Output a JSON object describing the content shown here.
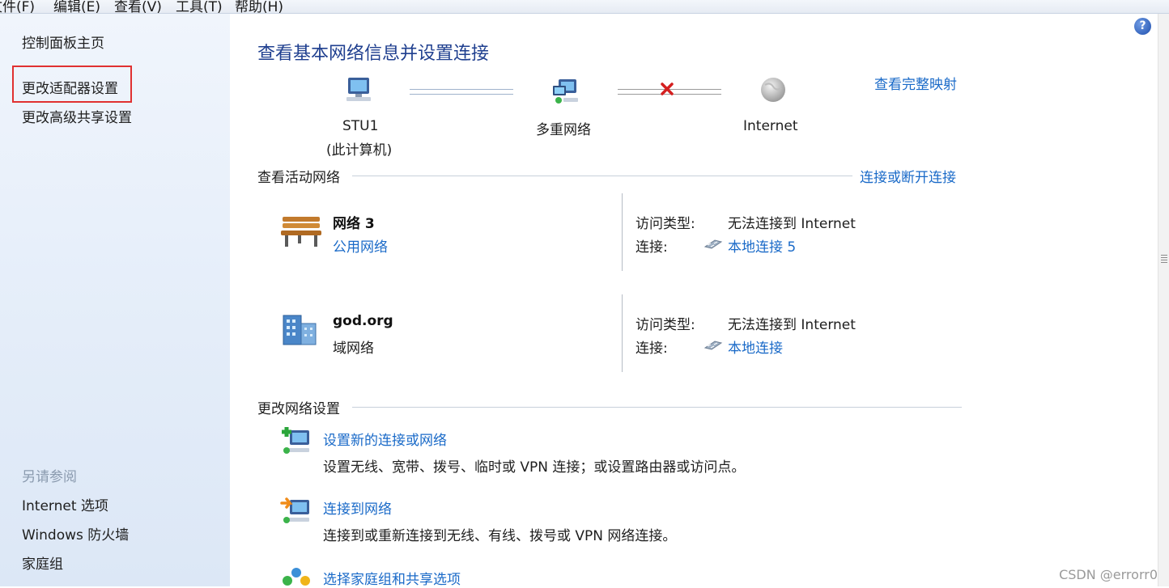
{
  "menu": [
    "文件(F)",
    "编辑(E)",
    "查看(V)",
    "工具(T)",
    "帮助(H)"
  ],
  "sidebar": {
    "home": "控制面板主页",
    "links": [
      "更改适配器设置",
      "更改高级共享设置"
    ],
    "see_also_label": "另请参阅",
    "see_also": [
      "Internet 选项",
      "Windows 防火墙",
      "家庭组"
    ]
  },
  "main": {
    "title": "查看基本网络信息并设置连接",
    "map_link": "查看完整映射",
    "map": {
      "computer_name": "STU1",
      "computer_sub": "(此计算机)",
      "network": "多重网络",
      "internet": "Internet"
    },
    "active_section": "查看活动网络",
    "connect_link": "连接或断开连接",
    "networks": [
      {
        "name": "网络  3",
        "type": "公用网络",
        "access_label": "访问类型:",
        "access_value": "无法连接到 Internet",
        "conn_label": "连接:",
        "conn_value": "本地连接 5",
        "icon": "park-bench-icon"
      },
      {
        "name": "god.org",
        "type": "域网络",
        "access_label": "访问类型:",
        "access_value": "无法连接到 Internet",
        "conn_label": "连接:",
        "conn_value": "本地连接",
        "icon": "domain-building-icon"
      }
    ],
    "change_section": "更改网络设置",
    "tasks": [
      {
        "title": "设置新的连接或网络",
        "desc": "设置无线、宽带、拨号、临时或 VPN 连接；或设置路由器或访问点。"
      },
      {
        "title": "连接到网络",
        "desc": "连接到或重新连接到无线、有线、拨号或 VPN 网络连接。"
      },
      {
        "title": "选择家庭组和共享选项",
        "desc": ""
      }
    ]
  },
  "watermark": "CSDN @errorr0",
  "colors": {
    "link": "#1a6ac8",
    "title": "#1f3f8f",
    "highlight": "#e03131",
    "sidebar_bg": "#e4edf9"
  }
}
